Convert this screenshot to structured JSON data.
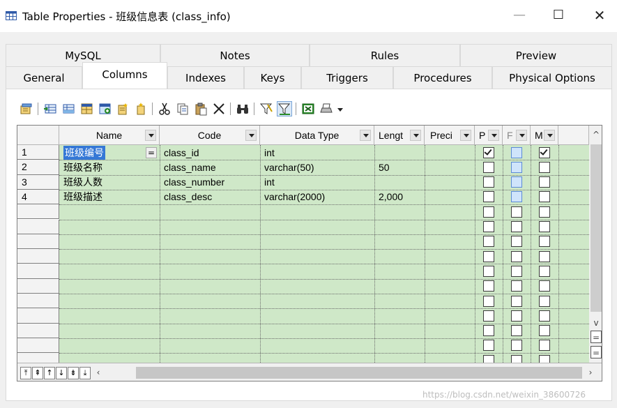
{
  "window": {
    "title": "Table Properties - 班级信息表 (class_info)",
    "minimize": "—",
    "maximize": "☐",
    "close": "✕"
  },
  "tabs": {
    "row1": [
      "MySQL",
      "Notes",
      "Rules",
      "Preview"
    ],
    "row2": [
      "General",
      "Columns",
      "Indexes",
      "Keys",
      "Triggers",
      "Procedures",
      "Physical Options"
    ],
    "active": "Columns"
  },
  "toolbar": {
    "icons": [
      "properties-icon",
      "insert-row-icon",
      "add-row-icon",
      "add-columns-icon",
      "add-attribute-icon",
      "new-icon",
      "paste-attribute-icon",
      "cut-icon",
      "copy-icon",
      "paste-icon",
      "delete-icon",
      "find-icon",
      "filter-icon",
      "customize-columns-icon",
      "excel-icon",
      "print-icon",
      "dropdown-icon"
    ]
  },
  "grid": {
    "columns": [
      "Name",
      "Code",
      "Data Type",
      "Lengt",
      "Preci",
      "P",
      "F",
      "M"
    ],
    "rows": [
      {
        "num": "1",
        "name": "班级编号",
        "code": "class_id",
        "type": "int",
        "length": "",
        "precision": "",
        "p": true,
        "f": false,
        "m": true
      },
      {
        "num": "2",
        "name": "班级名称",
        "code": "class_name",
        "type": "varchar(50)",
        "length": "50",
        "precision": "",
        "p": false,
        "f": false,
        "m": false
      },
      {
        "num": "3",
        "name": "班级人数",
        "code": "class_number",
        "type": "int",
        "length": "",
        "precision": "",
        "p": false,
        "f": false,
        "m": false
      },
      {
        "num": "4",
        "name": "班级描述",
        "code": "class_desc",
        "type": "varchar(2000)",
        "length": "2,000",
        "precision": "",
        "p": false,
        "f": false,
        "m": false
      }
    ],
    "equals_glyph": "="
  },
  "watermark": "https://blog.csdn.net/weixin_38600726"
}
